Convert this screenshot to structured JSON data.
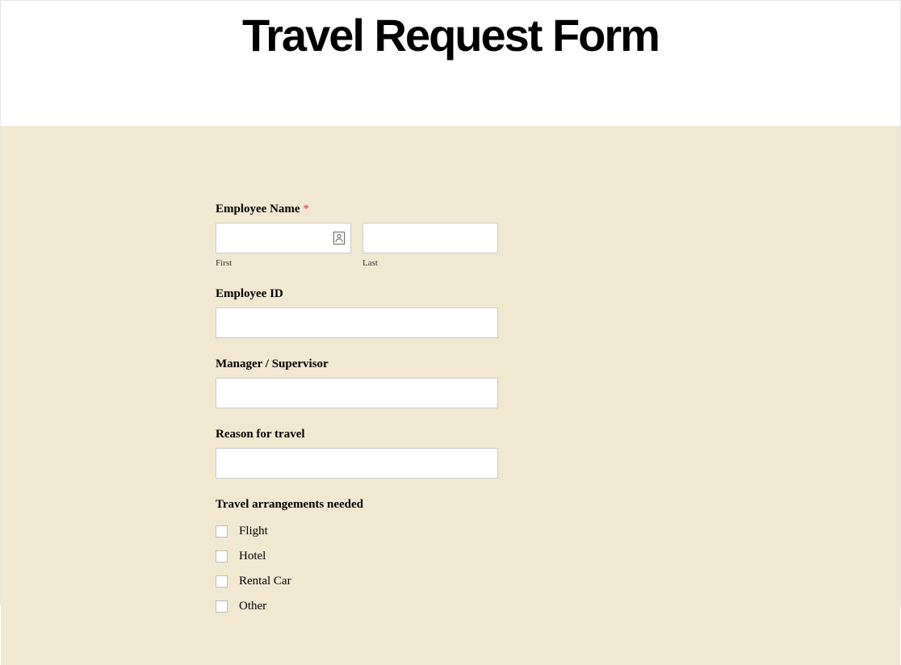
{
  "header": {
    "title": "Travel Request Form"
  },
  "form": {
    "employeeName": {
      "label": "Employee Name",
      "requiredMark": "*",
      "firstSubLabel": "First",
      "lastSubLabel": "Last",
      "firstValue": "",
      "lastValue": ""
    },
    "employeeId": {
      "label": "Employee ID",
      "value": ""
    },
    "manager": {
      "label": "Manager / Supervisor",
      "value": ""
    },
    "reason": {
      "label": "Reason for travel",
      "value": ""
    },
    "arrangements": {
      "label": "Travel arrangements needed",
      "options": [
        {
          "label": "Flight",
          "checked": false
        },
        {
          "label": "Hotel",
          "checked": false
        },
        {
          "label": "Rental Car",
          "checked": false
        },
        {
          "label": "Other",
          "checked": false
        }
      ]
    }
  }
}
